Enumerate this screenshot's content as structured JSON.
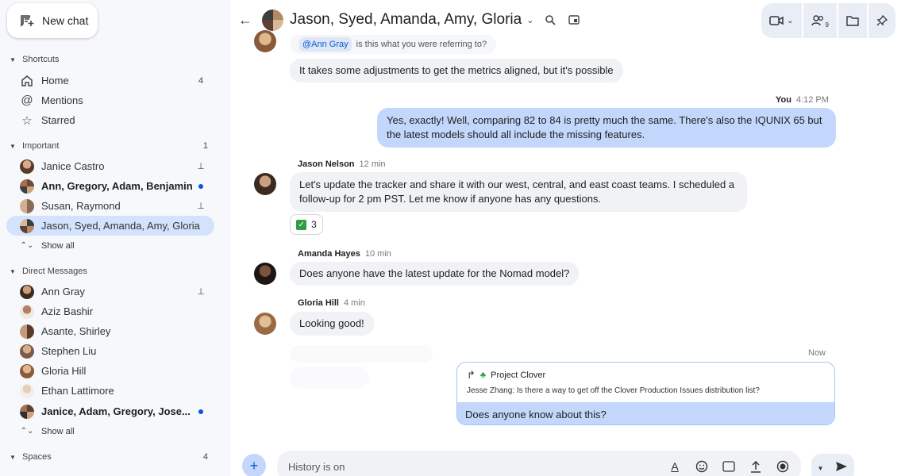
{
  "sidebar": {
    "new_chat": "New chat",
    "shortcuts": {
      "title": "Shortcuts",
      "items": [
        {
          "label": "Home",
          "count": "4",
          "icon": "home-icon"
        },
        {
          "label": "Mentions",
          "count": "",
          "icon": "at-icon"
        },
        {
          "label": "Starred",
          "count": "",
          "icon": "star-icon"
        }
      ]
    },
    "important": {
      "title": "Important",
      "count": "1",
      "items": [
        {
          "label": "Janice Castro"
        },
        {
          "label": "Ann, Gregory, Adam, Benjamin"
        },
        {
          "label": "Susan, Raymond"
        },
        {
          "label": "Jason, Syed, Amanda, Amy, Gloria"
        }
      ],
      "show_all": "Show all"
    },
    "direct_messages": {
      "title": "Direct Messages",
      "items": [
        {
          "label": "Ann Gray"
        },
        {
          "label": "Aziz Bashir"
        },
        {
          "label": "Asante, Shirley"
        },
        {
          "label": "Stephen Liu"
        },
        {
          "label": "Gloria Hill"
        },
        {
          "label": "Ethan Lattimore"
        },
        {
          "label": "Janice, Adam, Gregory, Jose..."
        }
      ],
      "show_all": "Show all"
    },
    "spaces": {
      "title": "Spaces",
      "count": "4"
    }
  },
  "header": {
    "title": "Jason, Syed, Amanda, Amy, Gloria",
    "people_count": "9"
  },
  "messages": {
    "quoted_mention": "@Ann Gray",
    "quoted_text": "is this what you were referring to?",
    "m1": "It takes some adjustments to get the metrics aligned, but it's possible",
    "you_label": "You",
    "you_time": "4:12 PM",
    "m2_line1": "Yes, exactly! Well, comparing 82 to 84 is pretty much the same. There's also the IQUNIX 65 but",
    "m2_line2": "the latest models should all include the missing features.",
    "jason_name": "Jason Nelson",
    "jason_time": "12 min",
    "m3_line1": "Let's update the tracker and share it with our west, central, and east coast teams. I scheduled a",
    "m3_line2": "follow-up for 2 pm PST. Let me know if anyone has any questions.",
    "reaction_count": "3",
    "amanda_name": "Amanda Hayes",
    "amanda_time": "10 min",
    "m4": "Does anyone have the latest update for the Nomad model?",
    "gloria_name": "Gloria Hill",
    "gloria_time": "4 min",
    "m5": "Looking good!",
    "now_label": "Now",
    "forward": {
      "space": "Project Clover",
      "quote": "Jesse Zhang: Is there a way to get off the Clover Production Issues distribution list?",
      "text": "Does anyone know about this?"
    }
  },
  "composer": {
    "placeholder": "History is on"
  }
}
